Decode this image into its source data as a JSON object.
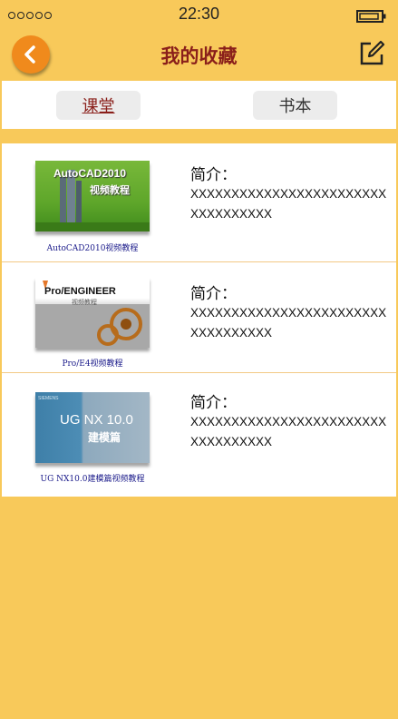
{
  "status": {
    "time": "22:30"
  },
  "header": {
    "title": "我的收藏"
  },
  "tabs": [
    {
      "label": "课堂"
    },
    {
      "label": "书本"
    }
  ],
  "items": [
    {
      "cover_title": "AutoCAD2010",
      "cover_subtitle": "视频教程",
      "caption": "AutoCAD2010视频教程",
      "intro_label": "简介：",
      "desc": "XXXXXXXXXXXXXXXXXXXXXXXXXXXXXXXXXX"
    },
    {
      "cover_title": "Pro/ENGINEER",
      "cover_subtitle": "视频教程",
      "caption": "Pro/E4视频教程",
      "intro_label": "简介：",
      "desc": "XXXXXXXXXXXXXXXXXXXXXXXXXXXXXXXXXX"
    },
    {
      "cover_brand": "SIEMENS",
      "cover_title": "UG NX 10.0",
      "cover_subtitle": "建模篇",
      "caption": "UG NX10.0建模篇视频教程",
      "intro_label": "简介：",
      "desc": "XXXXXXXXXXXXXXXXXXXXXXXXXXXXXXXXXX"
    }
  ],
  "colors": {
    "background": "#f8c95a",
    "accent": "#f08a1c",
    "title": "#8a1f1a"
  }
}
